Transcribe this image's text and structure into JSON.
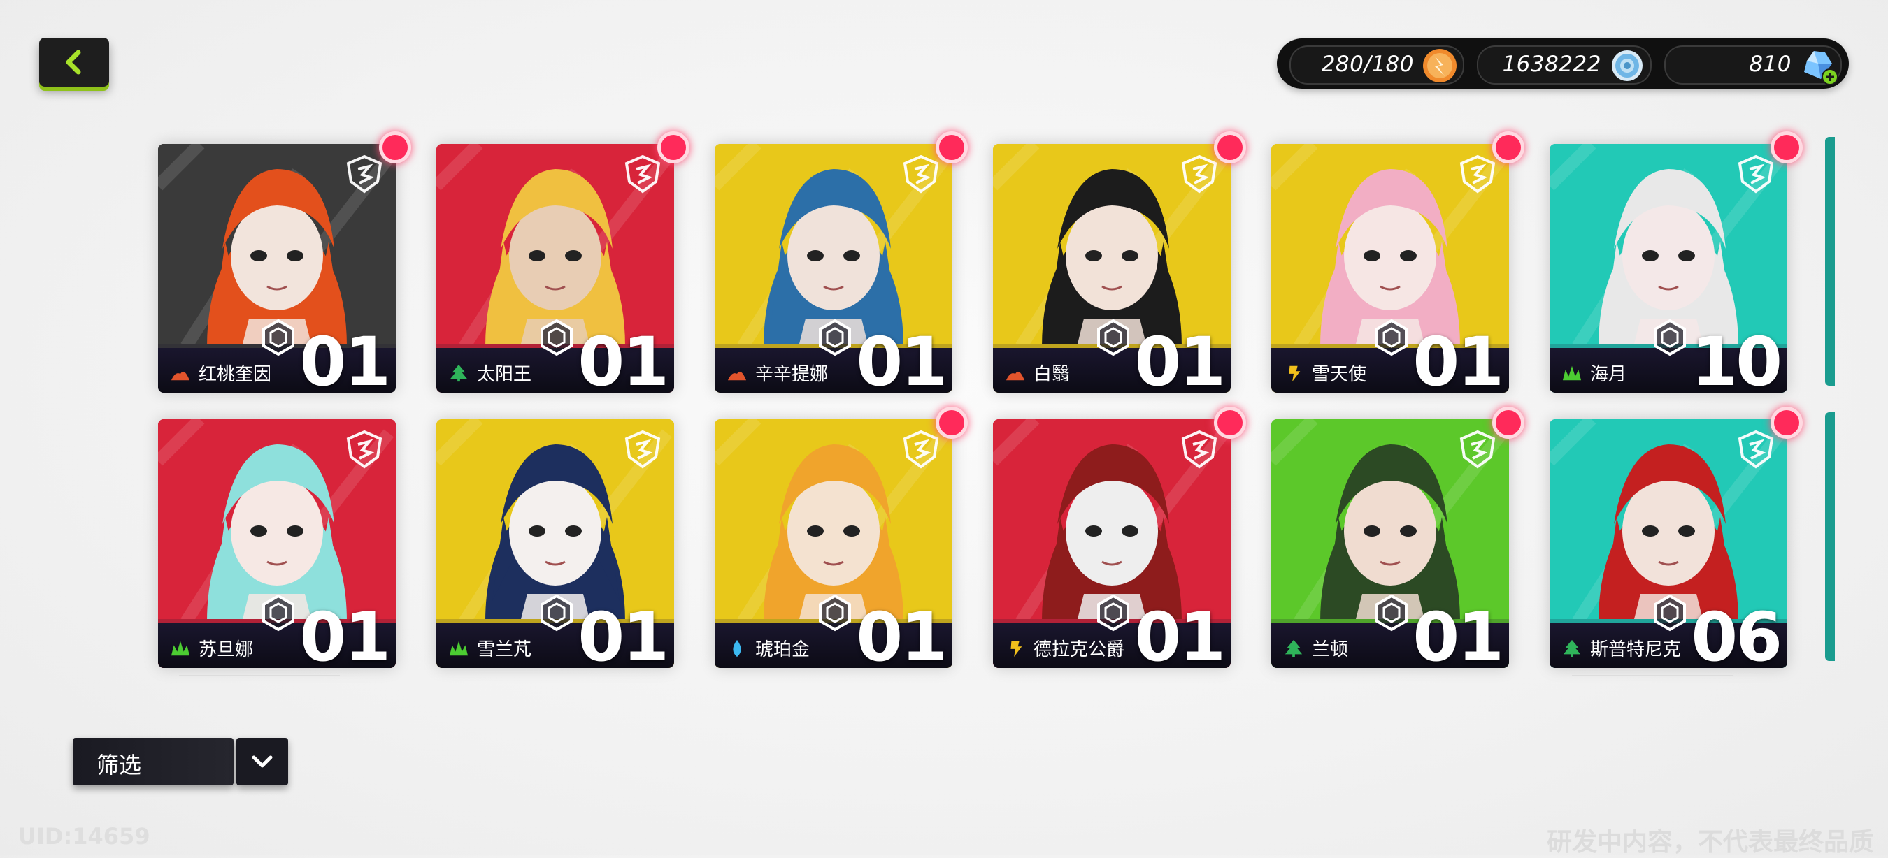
{
  "header": {
    "back_button": "chevron-left-icon"
  },
  "currencies": {
    "stamina": {
      "value": "280/180",
      "icon": "stamina-orb-icon",
      "color": "#f08a2c"
    },
    "coins": {
      "value": "1638222",
      "icon": "coin-stack-icon",
      "color": "#6fb6e6"
    },
    "gems": {
      "value": "810",
      "icon": "crystal-gem-icon",
      "color": "#7bc4ff",
      "add_icon": "plus-icon"
    }
  },
  "characters": [
    {
      "name": "红桃奎因",
      "level": "01",
      "element": "fire",
      "element_color": "#e2542c",
      "bg": "#3a3a3a",
      "hair": "#e3501c",
      "skin": "#f2e4dc",
      "new": true
    },
    {
      "name": "太阳王",
      "level": "01",
      "element": "forest",
      "element_color": "#2fb45a",
      "bg": "#d8243a",
      "hair": "#f0c040",
      "skin": "#e8cdb4",
      "new": true
    },
    {
      "name": "辛辛提娜",
      "level": "01",
      "element": "fire",
      "element_color": "#e2542c",
      "bg": "#e8c81a",
      "hair": "#2c6fa8",
      "skin": "#f0e2da",
      "new": true
    },
    {
      "name": "白翳",
      "level": "01",
      "element": "fire",
      "element_color": "#e2542c",
      "bg": "#e8c81a",
      "hair": "#1c1c1c",
      "skin": "#f2e2d8",
      "new": true
    },
    {
      "name": "雪天使",
      "level": "01",
      "element": "thunder",
      "element_color": "#f2c01c",
      "bg": "#e8c81a",
      "hair": "#f2aec4",
      "skin": "#f6e6e4",
      "new": true
    },
    {
      "name": "海月",
      "level": "10",
      "element": "grass",
      "element_color": "#4ccc32",
      "bg": "#22c9b6",
      "hair": "#e8e8e8",
      "skin": "#f4e8e8",
      "new": true
    },
    {
      "name": "苏旦娜",
      "level": "01",
      "element": "grass",
      "element_color": "#4ccc32",
      "bg": "#d8243a",
      "hair": "#8ee0dc",
      "skin": "#f6e8e4",
      "new": false
    },
    {
      "name": "雪兰芃",
      "level": "01",
      "element": "grass",
      "element_color": "#4ccc32",
      "bg": "#e8c81a",
      "hair": "#1d2f5e",
      "skin": "#f4f0ee",
      "new": false
    },
    {
      "name": "琥珀金",
      "level": "01",
      "element": "water",
      "element_color": "#3cb8f0",
      "bg": "#e8c81a",
      "hair": "#f0a42c",
      "skin": "#f4e2d0",
      "new": true
    },
    {
      "name": "德拉克公爵",
      "level": "01",
      "element": "thunder",
      "element_color": "#f2c01c",
      "bg": "#d8243a",
      "hair": "#8e1c1c",
      "skin": "#eeeeee",
      "new": true
    },
    {
      "name": "兰顿",
      "level": "01",
      "element": "forest",
      "element_color": "#2fb45a",
      "bg": "#5cc82a",
      "hair": "#2c4a24",
      "skin": "#f0dcd0",
      "new": true
    },
    {
      "name": "斯普特尼克",
      "level": "06",
      "element": "forest",
      "element_color": "#2fb45a",
      "bg": "#22c9b6",
      "hair": "#c42020",
      "skin": "#f2e2da",
      "new": true
    }
  ],
  "filter": {
    "label": "筛选",
    "dropdown_icon": "chevron-down-icon"
  },
  "footer": {
    "uid": "UID:14659",
    "disclaimer": "研发中内容，不代表最终品质"
  }
}
